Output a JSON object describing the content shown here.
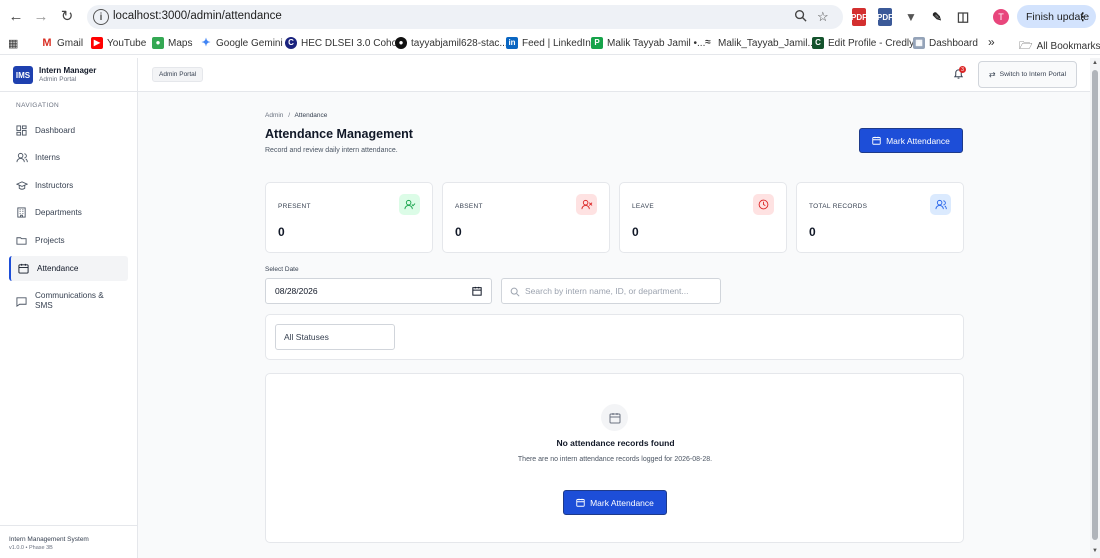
{
  "browser": {
    "url": "localhost:3000/admin/attendance",
    "profile_initial": "T",
    "finish_update": "Finish update",
    "bookmarks": [
      "Gmail",
      "YouTube",
      "Maps",
      "Google Gemini",
      "HEC DLSEI 3.0 Coho...",
      "tayyabjamil628-stac...",
      "Feed | LinkedIn",
      "Malik Tayyab Jamil •...",
      "Malik_Tayyab_Jamil...",
      "Edit Profile - Credly",
      "Dashboard"
    ],
    "all_bookmarks": "All Bookmarks",
    "more": "»"
  },
  "sidebar": {
    "brand_title": "Intern Manager",
    "brand_sub": "Admin Portal",
    "logo": "IMS",
    "nav_heading": "NAVIGATION",
    "items": [
      {
        "label": "Dashboard",
        "icon": "dashboard-icon"
      },
      {
        "label": "Interns",
        "icon": "users-icon"
      },
      {
        "label": "Instructors",
        "icon": "graduation-cap-icon"
      },
      {
        "label": "Departments",
        "icon": "building-icon"
      },
      {
        "label": "Projects",
        "icon": "folder-icon"
      },
      {
        "label": "Attendance",
        "icon": "calendar-icon",
        "active": true
      },
      {
        "label": "Communications & SMS",
        "icon": "message-icon"
      }
    ],
    "footer_title": "Intern Management System",
    "footer_version": "v1.0.0 • Phase 3B"
  },
  "topbar": {
    "portal_badge": "Admin Portal",
    "notification_count": "3",
    "switch_label": "Switch to Intern Portal"
  },
  "page": {
    "breadcrumb_root": "Admin",
    "breadcrumb_sep": "/",
    "breadcrumb_current": "Attendance",
    "title": "Attendance Management",
    "subtitle": "Record and review daily intern attendance.",
    "mark_button": "Mark Attendance"
  },
  "stats": [
    {
      "label": "PRESENT",
      "value": "0",
      "color": "#16a34a",
      "bg": "#dcfce7"
    },
    {
      "label": "ABSENT",
      "value": "0",
      "color": "#dc2626",
      "bg": "#fee2e2"
    },
    {
      "label": "LEAVE",
      "value": "0",
      "color": "#d97706",
      "bg": "#fef3c7"
    },
    {
      "label": "TOTAL RECORDS",
      "value": "0",
      "color": "#2563eb",
      "bg": "#dbeafe"
    }
  ],
  "filters": {
    "date_label": "Select Date",
    "date_value": "08/28/2026",
    "search_placeholder": "Search by intern name, ID, or department...",
    "status_select": "All Statuses"
  },
  "empty": {
    "title": "No attendance records found",
    "description": "There are no intern attendance records logged for 2026-08-28.",
    "button": "Mark Attendance"
  }
}
